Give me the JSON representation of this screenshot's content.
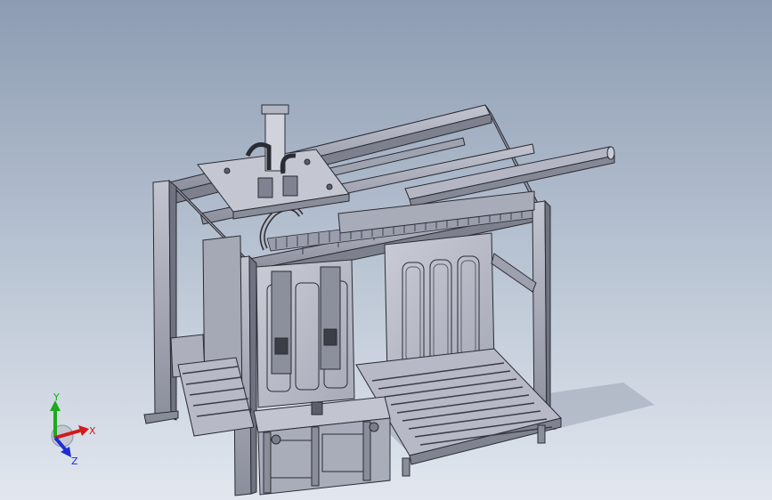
{
  "viewport": {
    "background_top": "#8d9cb2",
    "background_bottom": "#e2e7ef"
  },
  "model": {
    "frame_color": "#a3a6b4",
    "frame_shadow": "#6d707e",
    "panel_color": "#b9bcc8",
    "edge_color": "#2a2c33",
    "shadow_color": "#9aa3b3"
  },
  "triad": {
    "x_label": "X",
    "y_label": "Y",
    "z_label": "Z",
    "x_color": "#d11a1a",
    "y_color": "#1ea81e",
    "z_color": "#1b2ed6"
  }
}
